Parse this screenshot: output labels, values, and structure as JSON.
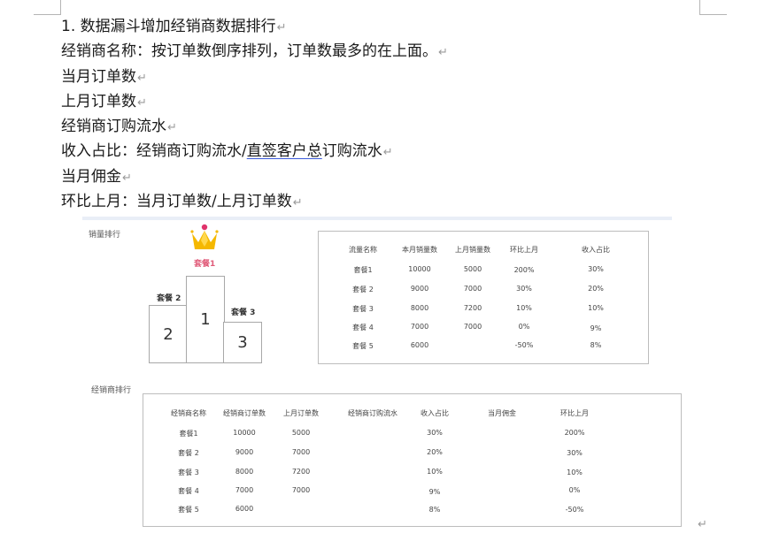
{
  "doc": {
    "lines": [
      "1.  数据漏斗增加经销商数据排行",
      "经销商名称：按订单数倒序排列，订单数最多的在上面。",
      "当月订单数",
      "上月订单数",
      "经销商订购流水"
    ],
    "ratio_prefix": "收入占比：经销商订购流水/",
    "ratio_underlined": "直签客户总",
    "ratio_suffix": "订购流水",
    "lines_after": [
      "当月佣金",
      "环比上月：当月订单数/上月订单数"
    ],
    "para_mark": "↵"
  },
  "figure": {
    "sales_rank_label": "销量排行",
    "dealer_rank_label": "经销商排行",
    "podium": {
      "first_name": "套餐1",
      "second_name": "套餐 2",
      "third_name": "套餐 3",
      "first_rank": "1",
      "second_rank": "2",
      "third_rank": "3"
    },
    "sales_table": {
      "headers": [
        "流量名称",
        "本月销量数",
        "上月销量数",
        "环比上月",
        "收入占比"
      ],
      "rows": [
        [
          "套餐1",
          "10000",
          "5000",
          "200%",
          "30%"
        ],
        [
          "套餐 2",
          "9000",
          "7000",
          "30%",
          "20%"
        ],
        [
          "套餐 3",
          "8000",
          "7200",
          "10%",
          "10%"
        ],
        [
          "套餐 4",
          "7000",
          "7000",
          "0%",
          "9%"
        ],
        [
          "套餐 5",
          "6000",
          "",
          "-50%",
          "8%"
        ]
      ]
    },
    "dealer_table": {
      "headers": [
        "经销商名称",
        "经销商订单数",
        "上月订单数",
        "经销商订购流水",
        "收入占比",
        "当月佣金",
        "环比上月"
      ],
      "rows": [
        [
          "套餐1",
          "10000",
          "5000",
          "",
          "30%",
          "",
          "200%"
        ],
        [
          "套餐 2",
          "9000",
          "7000",
          "",
          "20%",
          "",
          "30%"
        ],
        [
          "套餐 3",
          "8000",
          "7200",
          "",
          "10%",
          "",
          "10%"
        ],
        [
          "套餐 4",
          "7000",
          "7000",
          "",
          "9%",
          "",
          "0%"
        ],
        [
          "套餐 5",
          "6000",
          "",
          "",
          "8%",
          "",
          "-50%"
        ]
      ]
    }
  },
  "colors": {
    "crown_gold": "#f5b800",
    "crown_jewel": "#e0336b",
    "first_label": "#e05a78"
  }
}
